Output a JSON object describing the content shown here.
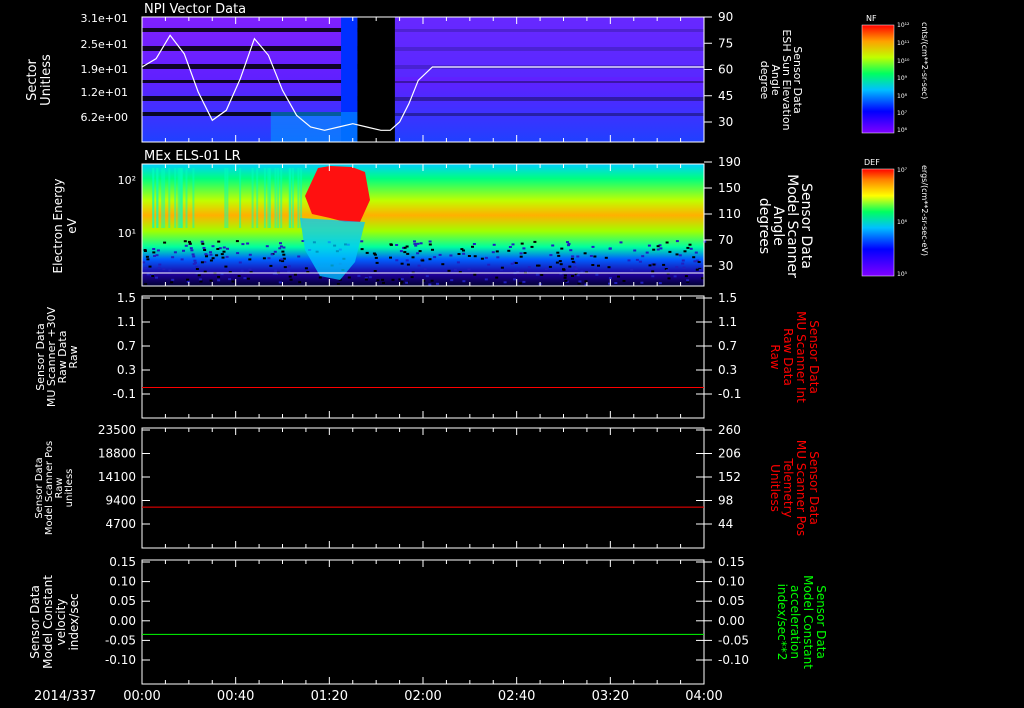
{
  "time_axis": {
    "date_label": "2014/337",
    "tick_labels": [
      "00:00",
      "00:40",
      "01:20",
      "02:00",
      "02:40",
      "03:20",
      "04:00"
    ],
    "range_minutes": [
      0,
      240
    ]
  },
  "chart_data": [
    {
      "type": "heatmap",
      "title": "NPI Vector Data",
      "ylabel_left": [
        "Sector",
        "Unitless"
      ],
      "yticks_left": [
        "3.1e+01",
        "2.5e+01",
        "1.9e+01",
        "1.2e+01",
        "6.2e+00"
      ],
      "ylabel_right": [
        "Sensor Data",
        "ESH Sun Elevation",
        "Angle",
        "degree"
      ],
      "yticks_right": [
        "90",
        "75",
        "60",
        "45",
        "30"
      ],
      "ylim_right": [
        15,
        90
      ],
      "overlay_line": {
        "color": "#ffffff",
        "x_minutes": [
          0,
          6,
          12,
          18,
          24,
          30,
          36,
          42,
          48,
          54,
          60,
          66,
          72,
          78,
          84,
          90,
          96,
          102,
          106,
          110,
          114,
          118,
          124,
          132,
          140,
          160,
          200,
          240
        ],
        "y_degrees": [
          60,
          65,
          79,
          68,
          45,
          28,
          34,
          53,
          77,
          67,
          46,
          31,
          24,
          22,
          24,
          26,
          24,
          22,
          22,
          27,
          38,
          52,
          60,
          60,
          60,
          60,
          60,
          60
        ]
      },
      "data_gap_minutes": [
        92,
        108
      ],
      "colorbar": {
        "label": "NF",
        "ticks": [
          "10¹²",
          "10¹¹",
          "10¹⁰",
          "10⁹",
          "10⁸",
          "10⁷",
          "10⁶"
        ],
        "units": "cnts/(cm**2-sr-sec)"
      }
    },
    {
      "type": "heatmap",
      "title": "MEx ELS-01 LR",
      "ylabel_left": [
        "Electron Energy",
        "eV"
      ],
      "yticks_left": [
        "10²",
        "10¹"
      ],
      "ylabel_right": [
        "Sensor Data",
        "Model Scanner",
        "Angle",
        "degrees"
      ],
      "yticks_right": [
        "190",
        "150",
        "110",
        "70",
        "30"
      ],
      "ylim_right": [
        0,
        190
      ],
      "colorbar": {
        "label": "DEF",
        "ticks": [
          "10⁷",
          "10⁶",
          "10⁵"
        ],
        "units": "ergs/(cm**2-sr-sec-eV)"
      }
    },
    {
      "type": "line",
      "ylabel_left": [
        "Sensor Data",
        "MU Scanner +30V",
        "Raw Data",
        "Raw"
      ],
      "yticks_left": [
        "1.5",
        "1.1",
        "0.7",
        "0.3",
        "-0.1"
      ],
      "ylabel_right": [
        "Sensor Data",
        "MU Scanner Int",
        "Raw Data",
        "Raw"
      ],
      "yticks_right": [
        "1.5",
        "1.1",
        "0.7",
        "0.3",
        "-0.1"
      ],
      "ylim": [
        -0.5,
        1.5
      ],
      "right_label_color": "#ff0000",
      "series": [
        {
          "color": "#ff0000",
          "x": [
            0,
            240
          ],
          "y": [
            0.0,
            0.0
          ]
        }
      ]
    },
    {
      "type": "line",
      "ylabel_left": [
        "Sensor Data",
        "Model Scanner Pos",
        "Raw",
        "unitless"
      ],
      "yticks_left": [
        "23500",
        "18800",
        "14100",
        "9400",
        "4700"
      ],
      "ylabel_right": [
        "Sensor Data",
        "MU Scanner Pos",
        "Telemetry",
        "Unitless"
      ],
      "yticks_right": [
        "260",
        "206",
        "152",
        "98",
        "44"
      ],
      "ylim": [
        0,
        23500
      ],
      "right_label_color": "#ff0000",
      "series": [
        {
          "color": "#ff0000",
          "x": [
            0,
            240
          ],
          "y": [
            8000,
            8000
          ]
        }
      ]
    },
    {
      "type": "line",
      "ylabel_left": [
        "Sensor Data",
        "Model Constant",
        "velocity",
        "index/sec"
      ],
      "yticks_left": [
        "0.15",
        "0.10",
        "0.05",
        "0.00",
        "-0.05",
        "-0.10"
      ],
      "ylabel_right": [
        "Sensor Data",
        "Model Constant",
        "acceleration",
        "index/sec**2"
      ],
      "yticks_right": [
        "0.15",
        "0.10",
        "0.05",
        "0.00",
        "-0.05",
        "-0.10"
      ],
      "ylim": [
        -0.1,
        0.15
      ],
      "right_label_color": "#00ff00",
      "series": [
        {
          "color": "#00ff00",
          "x": [
            0,
            240
          ],
          "y": [
            0.0,
            0.0
          ]
        }
      ]
    }
  ]
}
